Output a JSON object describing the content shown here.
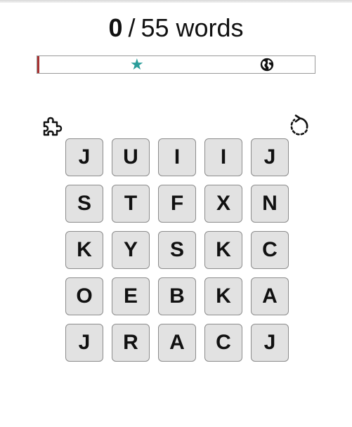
{
  "score": {
    "found": "0",
    "separator": "/",
    "total": "55 words"
  },
  "progress": {
    "fraction": 0.0,
    "fill_color": "#a83232",
    "milestone_icons": [
      "star-icon",
      "globe-icon"
    ],
    "star_color": "#2a9d9a"
  },
  "controls": {
    "hint_icon": "puzzle-piece-icon",
    "shuffle_icon": "rotate-icon"
  },
  "grid": {
    "rows": [
      [
        "J",
        "U",
        "I",
        "I",
        "J"
      ],
      [
        "S",
        "T",
        "F",
        "X",
        "N"
      ],
      [
        "K",
        "Y",
        "S",
        "K",
        "C"
      ],
      [
        "O",
        "E",
        "B",
        "K",
        "A"
      ],
      [
        "J",
        "R",
        "A",
        "C",
        "J"
      ]
    ]
  }
}
